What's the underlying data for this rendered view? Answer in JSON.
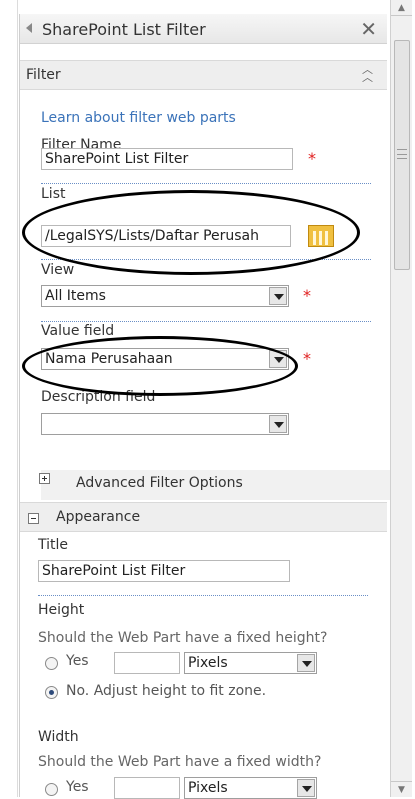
{
  "panel": {
    "title": "SharePoint List Filter"
  },
  "filter_section": {
    "label": "Filter",
    "learn_link": "Learn about filter web parts",
    "filter_name": {
      "label": "Filter Name",
      "value": "SharePoint List Filter"
    },
    "list": {
      "label": "List",
      "value": "/LegalSYS/Lists/Daftar Perusah"
    },
    "view": {
      "label": "View",
      "value": "All Items"
    },
    "value_field": {
      "label": "Value field",
      "value": "Nama Perusahaan"
    },
    "description_field": {
      "label": "Description field",
      "value": ""
    },
    "advanced_label": "Advanced Filter Options",
    "required_marker": "*"
  },
  "appearance_section": {
    "label": "Appearance",
    "title": {
      "label": "Title",
      "value": "SharePoint List Filter"
    },
    "height": {
      "label": "Height",
      "question": "Should the Web Part have a fixed height?",
      "yes_label": "Yes",
      "unit": "Pixels",
      "no_label": "No. Adjust height to fit zone."
    },
    "width": {
      "label": "Width",
      "question": "Should the Web Part have a fixed width?",
      "yes_label": "Yes",
      "unit": "Pixels"
    }
  },
  "colors": {
    "link": "#3b73b9",
    "required": "#e02020",
    "annotation": "#000000"
  }
}
